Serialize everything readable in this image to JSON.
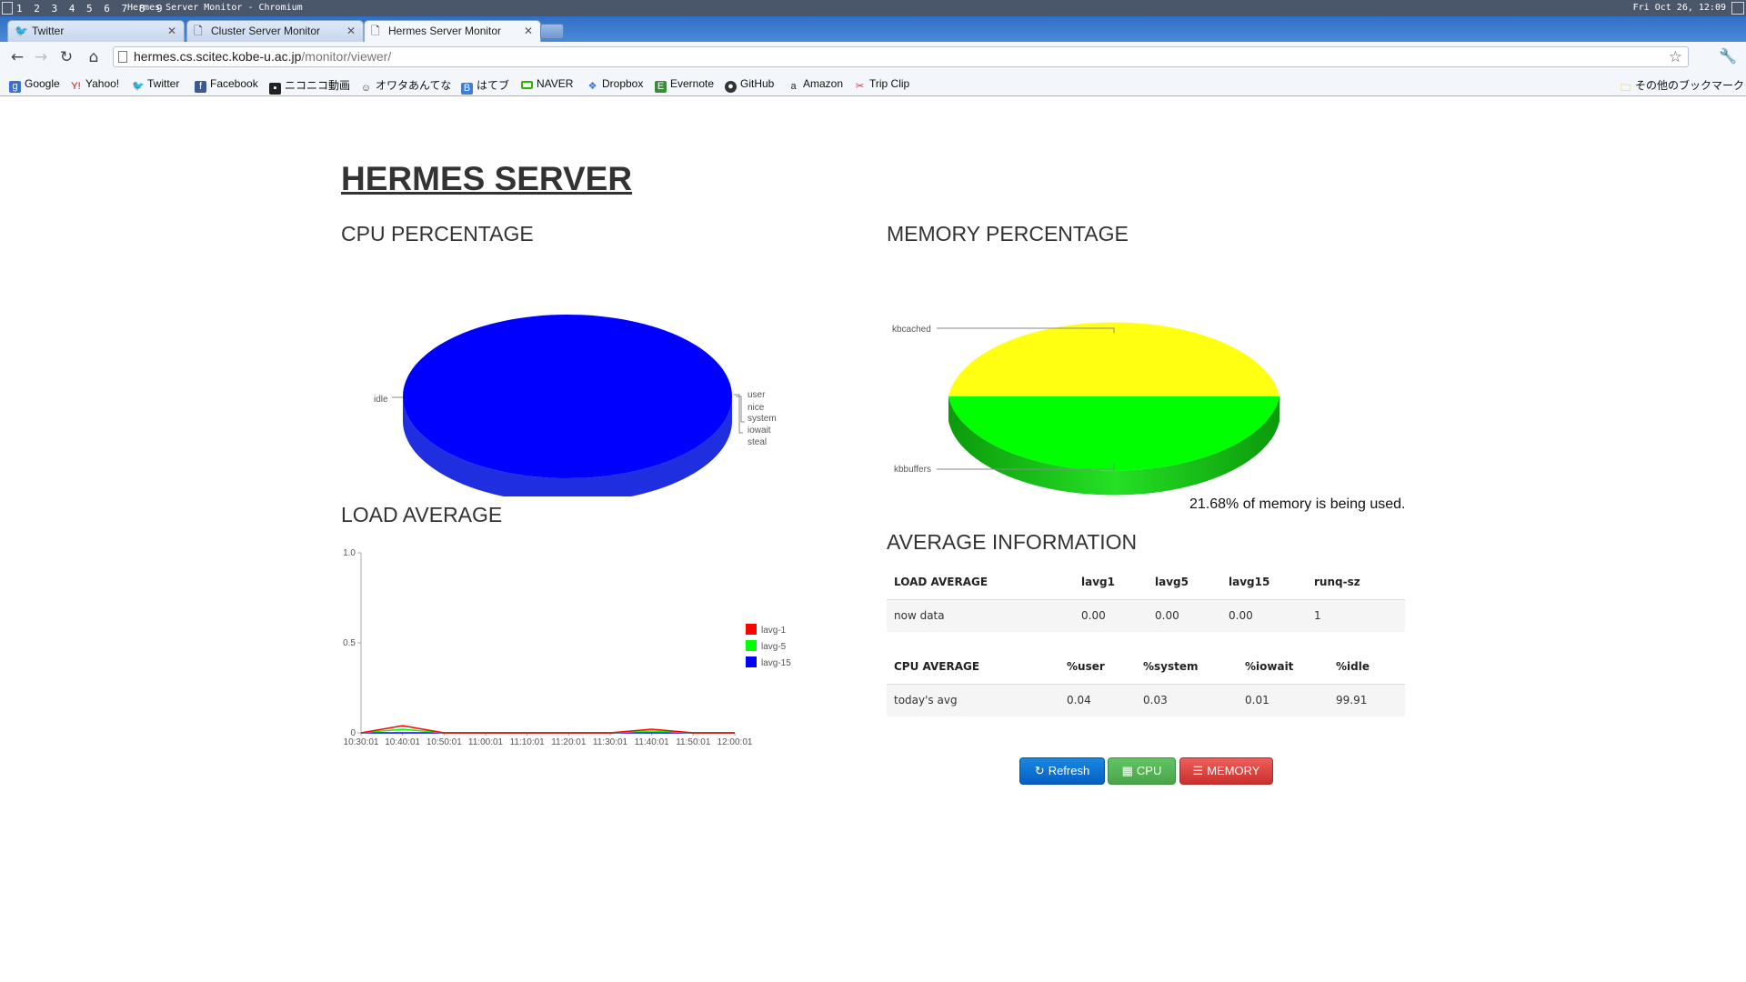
{
  "os": {
    "workspaces": "1 2 3 4 5 6 7 8 9",
    "window_title": "Hermes Server Monitor - Chromium",
    "clock": "Fri Oct 26, 12:09"
  },
  "tabs": [
    {
      "label": "Twitter"
    },
    {
      "label": "Cluster Server Monitor"
    },
    {
      "label": "Hermes Server Monitor"
    }
  ],
  "omnibox": {
    "host": "hermes.cs.scitec.kobe-u.ac.jp",
    "path": "/monitor/viewer/"
  },
  "bookmarks": [
    {
      "label": "Google",
      "icon": "google-icon"
    },
    {
      "label": "Yahoo!",
      "icon": "yahoo-icon"
    },
    {
      "label": "Twitter",
      "icon": "twitter-icon"
    },
    {
      "label": "Facebook",
      "icon": "facebook-icon"
    },
    {
      "label": "ニコニコ動画",
      "icon": "nicovideo-icon"
    },
    {
      "label": "オワタあんてな",
      "icon": "owata-icon"
    },
    {
      "label": "はてブ",
      "icon": "hatena-icon"
    },
    {
      "label": "NAVER",
      "icon": "naver-icon"
    },
    {
      "label": "Dropbox",
      "icon": "dropbox-icon"
    },
    {
      "label": "Evernote",
      "icon": "evernote-icon"
    },
    {
      "label": "GitHub",
      "icon": "github-icon"
    },
    {
      "label": "Amazon",
      "icon": "amazon-icon"
    },
    {
      "label": "Trip Clip",
      "icon": "tripclip-icon"
    }
  ],
  "other_bookmarks": "その他のブックマーク",
  "page": {
    "title": "HERMES SERVER",
    "cpu_heading": "CPU PERCENTAGE",
    "memory_heading": "MEMORY PERCENTAGE",
    "load_heading": "LOAD AVERAGE",
    "avg_heading": "AVERAGE INFORMATION",
    "memory_note": "21.68% of memory is being used."
  },
  "chart_data": [
    {
      "type": "pie",
      "labels": [
        "idle",
        "user",
        "nice",
        "system",
        "iowait",
        "steal"
      ],
      "values": [
        99.91,
        0.04,
        0.0,
        0.03,
        0.01,
        0.0
      ],
      "colors": [
        "#0000ff"
      ]
    },
    {
      "type": "pie",
      "labels": [
        "kbcached",
        "kbbuffers"
      ],
      "values": [
        50,
        50
      ],
      "colors": [
        "#ffff00",
        "#00ff00"
      ]
    },
    {
      "type": "line",
      "x": [
        "10:30:01",
        "10:40:01",
        "10:50:01",
        "11:00:01",
        "11:10:01",
        "11:20:01",
        "11:30:01",
        "11:40:01",
        "11:50:01",
        "12:00:01"
      ],
      "ylim": [
        0,
        1.0
      ],
      "yticks": [
        "0",
        "0.5",
        "1.0"
      ],
      "series": [
        {
          "name": "lavg-1",
          "color": "#ff0000",
          "values": [
            0,
            0.04,
            0,
            0,
            0,
            0,
            0,
            0.02,
            0,
            0
          ]
        },
        {
          "name": "lavg-5",
          "color": "#00ff00",
          "values": [
            0,
            0.02,
            0,
            0,
            0,
            0,
            0,
            0.01,
            0,
            0
          ]
        },
        {
          "name": "lavg-15",
          "color": "#0000ff",
          "values": [
            0,
            0,
            0,
            0,
            0,
            0,
            0,
            0,
            0,
            0
          ]
        }
      ],
      "legend": "right"
    }
  ],
  "load_table": {
    "headers": [
      "LOAD AVERAGE",
      "lavg1",
      "lavg5",
      "lavg15",
      "runq-sz"
    ],
    "row": [
      "now data",
      "0.00",
      "0.00",
      "0.00",
      "1"
    ]
  },
  "cpu_table": {
    "headers": [
      "CPU AVERAGE",
      "%user",
      "%system",
      "%iowait",
      "%idle"
    ],
    "row": [
      "today's avg",
      "0.04",
      "0.03",
      "0.01",
      "99.91"
    ]
  },
  "buttons": {
    "refresh": "Refresh",
    "cpu": "CPU",
    "memory": "MEMORY"
  }
}
